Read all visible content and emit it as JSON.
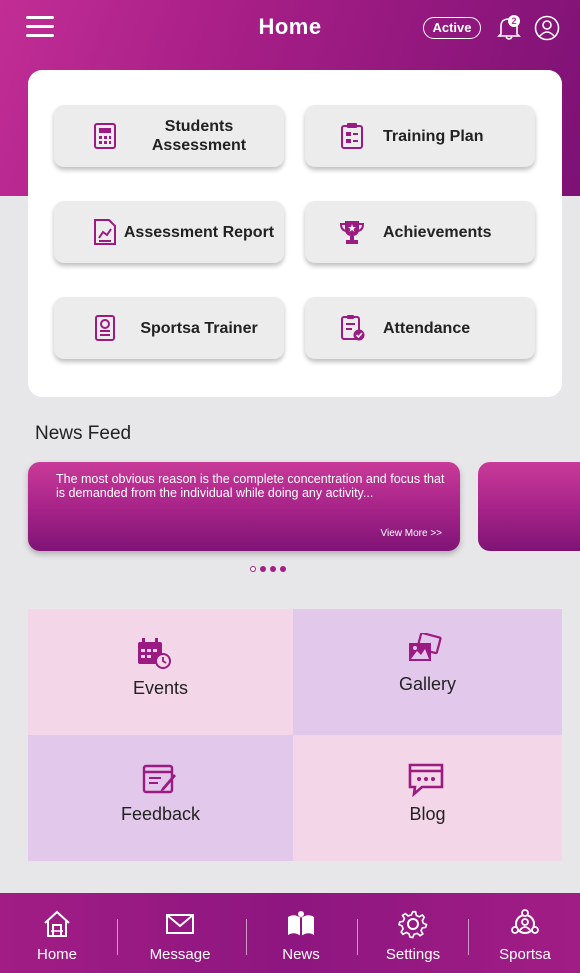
{
  "header": {
    "title": "Home",
    "status": "Active",
    "notification_count": "2"
  },
  "menu": {
    "items": [
      {
        "label": "Students Assessment",
        "icon": "calculator-report-icon"
      },
      {
        "label": "Training Plan",
        "icon": "clipboard-plan-icon"
      },
      {
        "label": "Assessment Report",
        "icon": "chart-report-icon"
      },
      {
        "label": "Achievements",
        "icon": "trophy-icon"
      },
      {
        "label": "Sportsa Trainer",
        "icon": "trainer-id-icon"
      },
      {
        "label": "Attendance",
        "icon": "attendance-check-icon"
      }
    ]
  },
  "news": {
    "title": "News Feed",
    "card_text": "The most obvious reason is the complete concentration and focus that is demanded from the individual while doing any activity...",
    "view_more": "View More >>"
  },
  "grid": {
    "items": [
      {
        "label": "Events",
        "icon": "calendar-clock-icon",
        "bg": "#f3d6e8"
      },
      {
        "label": "Gallery",
        "icon": "gallery-icon",
        "bg": "#e2c8ea"
      },
      {
        "label": "Feedback",
        "icon": "feedback-icon",
        "bg": "#e2c8ea"
      },
      {
        "label": "Blog",
        "icon": "chat-blog-icon",
        "bg": "#f3d6e8"
      }
    ]
  },
  "nav": {
    "items": [
      {
        "label": "Home",
        "icon": "home-icon"
      },
      {
        "label": "Message",
        "icon": "envelope-icon"
      },
      {
        "label": "News",
        "icon": "news-book-icon"
      },
      {
        "label": "Settings",
        "icon": "gear-icon"
      },
      {
        "label": "Sportsa",
        "icon": "sportsa-network-icon"
      }
    ]
  },
  "colors": {
    "primary": "#a51e86",
    "primary_dark": "#7d1175",
    "tile_bg": "#ececec",
    "page_bg": "#e7e6e9"
  }
}
